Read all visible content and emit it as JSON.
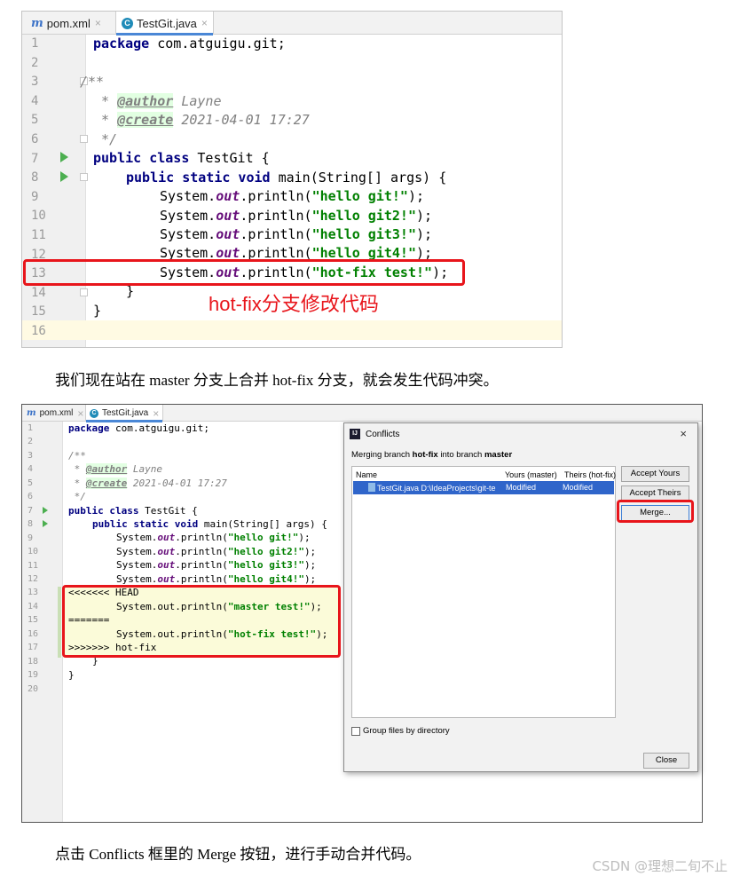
{
  "editor1": {
    "tabs": [
      {
        "label": "pom.xml",
        "icon": "maven-icon",
        "active": false
      },
      {
        "label": "TestGit.java",
        "icon": "java-class-icon",
        "active": true
      }
    ],
    "line_numbers": [
      "1",
      "2",
      "3",
      "4",
      "5",
      "6",
      "7",
      "8",
      "9",
      "10",
      "11",
      "12",
      "13",
      "14",
      "15",
      "16"
    ],
    "code": {
      "package_kw": "package",
      "package_name": " com.atguigu.git;",
      "doc_open": "/**",
      "author_tag": "@author",
      "author_val": " Layne",
      "create_tag": "@create",
      "create_val": " 2021-04-01 17:27",
      "doc_close": " */",
      "class_kw": "public class",
      "class_name": " TestGit {",
      "main_kw": "public static void",
      "main_sig": " main(String[] args) {",
      "print_prefix": "System.",
      "print_field": "out",
      "print_method": ".println(",
      "print_suffix": ");",
      "strings": [
        "\"hello git!\"",
        "\"hello git2!\"",
        "\"hello git3!\"",
        "\"hello git4!\"",
        "\"hot-fix test!\""
      ],
      "close_method": "}",
      "close_class": "}"
    },
    "annotation": "hot-fix分支修改代码"
  },
  "paragraph1": "我们现在站在 master 分支上合并 hot-fix 分支，就会发生代码冲突。",
  "editor2": {
    "tabs": [
      {
        "label": "pom.xml",
        "icon": "maven-icon",
        "active": false
      },
      {
        "label": "TestGit.java",
        "icon": "java-class-icon",
        "active": true
      }
    ],
    "line_numbers": [
      "1",
      "2",
      "3",
      "4",
      "5",
      "6",
      "7",
      "8",
      "9",
      "10",
      "11",
      "12",
      "13",
      "14",
      "15",
      "16",
      "17",
      "18",
      "19",
      "20"
    ],
    "conflict": {
      "head_marker": "<<<<<<< HEAD",
      "master_string": "\"master test!\"",
      "separator": "=======",
      "hotfix_string": "\"hot-fix test!\"",
      "end_marker": ">>>>>>> hot-fix",
      "plain_prefix": "System.out.println(",
      "plain_suffix": ");"
    }
  },
  "dialog": {
    "title": "Conflicts",
    "close_glyph": "×",
    "subtitle_prefix": "Merging branch ",
    "subtitle_branch1": "hot-fix",
    "subtitle_mid": " into branch ",
    "subtitle_branch2": "master",
    "columns": [
      "Name",
      "Yours (master)",
      "Theirs (hot-fix)"
    ],
    "row": {
      "name": "TestGit.java D:\\IdeaProjects\\git-te",
      "yours": "Modified",
      "theirs": "Modified"
    },
    "buttons": {
      "accept_yours": "Accept Yours",
      "accept_theirs": "Accept Theirs",
      "merge": "Merge...",
      "close": "Close"
    },
    "group_files_label": "Group files by directory"
  },
  "paragraph2": "点击 Conflicts 框里的 Merge 按钮，进行手动合并代码。",
  "watermark": "CSDN @理想二旬不止",
  "colors": {
    "highlight_red": "#e8151b",
    "selection_blue": "#2f65ca"
  }
}
